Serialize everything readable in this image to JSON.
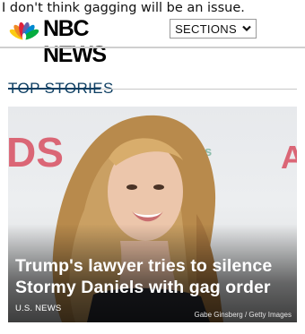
{
  "annotation": "I don't think gagging will be an issue.",
  "header": {
    "brand": "NBC NEWS",
    "sections_label": "SECTIONS",
    "brand_colors": [
      "#fccc12",
      "#ef8a23",
      "#e1213a",
      "#6460aa",
      "#0089d0",
      "#05ac3f"
    ]
  },
  "section": {
    "title": "TOP STORIES"
  },
  "story": {
    "headline": "Trump's lawyer tries to silence Stormy Daniels with gag order",
    "category": "U.S. NEWS",
    "credit": "Gabe Ginsberg / Getty Images",
    "backdrop_text": [
      "DS",
      "eCams",
      "A"
    ]
  }
}
